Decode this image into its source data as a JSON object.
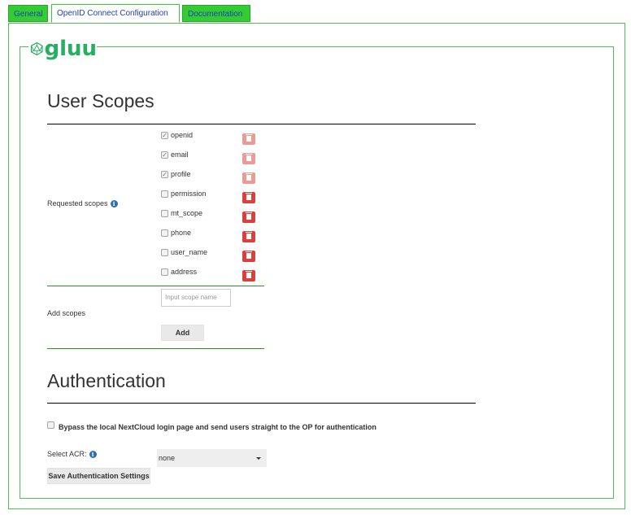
{
  "tabs": [
    {
      "label": "General"
    },
    {
      "label": "OpenID Connect Configuration"
    },
    {
      "label": "Documentation"
    }
  ],
  "logo": {
    "text": "gluu",
    "color": "#27ae60"
  },
  "user_scopes": {
    "title": "User Scopes",
    "requested_label": "Requested scopes",
    "scopes": [
      {
        "name": "openid",
        "checked": true,
        "delete_enabled": false
      },
      {
        "name": "email",
        "checked": true,
        "delete_enabled": false
      },
      {
        "name": "profile",
        "checked": true,
        "delete_enabled": false
      },
      {
        "name": "permission",
        "checked": false,
        "delete_enabled": true
      },
      {
        "name": "mt_scope",
        "checked": false,
        "delete_enabled": true
      },
      {
        "name": "phone",
        "checked": false,
        "delete_enabled": true
      },
      {
        "name": "user_name",
        "checked": false,
        "delete_enabled": true
      },
      {
        "name": "address",
        "checked": false,
        "delete_enabled": true
      }
    ],
    "add_label": "Add scopes",
    "input_placeholder": "Input scope name",
    "add_button": "Add"
  },
  "authentication": {
    "title": "Authentication",
    "bypass_label": "Bypass the local NextCloud login page and send users straight to the OP for authentication",
    "acr_label": "Select ACR:",
    "acr_value": "none",
    "save_button": "Save Authentication Settings"
  },
  "colors": {
    "tab_green": "#33cc33",
    "border_green": "#55bb55",
    "danger": "#d9413e",
    "info": "#2f6fb5"
  }
}
